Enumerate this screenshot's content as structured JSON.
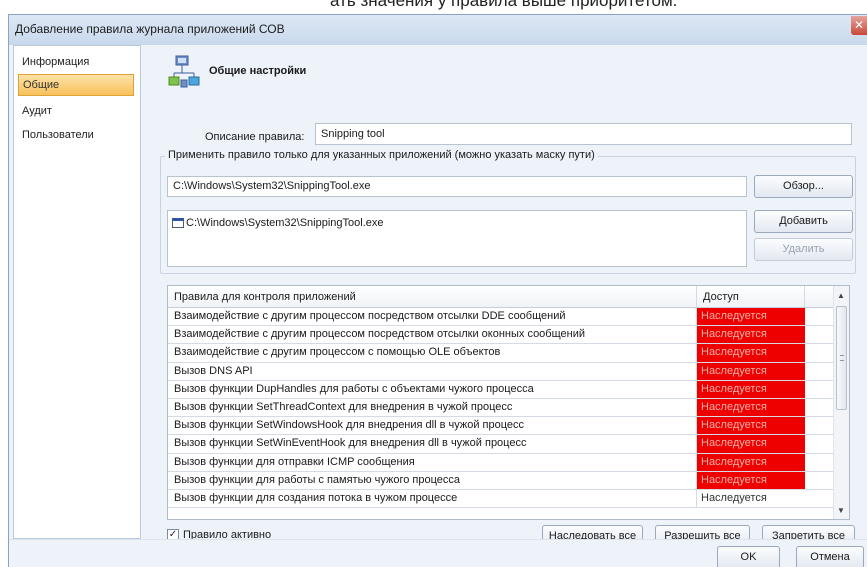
{
  "background_text": "ать значения у правила выше приоритетом.",
  "window": {
    "title": "Добавление правила журнала приложений СОВ",
    "close_glyph": "✕"
  },
  "sidebar": {
    "items": [
      {
        "label": "Информация"
      },
      {
        "label": "Общие",
        "active": true
      },
      {
        "label": "Аудит"
      },
      {
        "label": "Пользователи"
      }
    ]
  },
  "header": {
    "title": "Общие настройки",
    "icon": "settings-network-icon"
  },
  "description": {
    "label": "Описание правила:",
    "value": "Snipping tool"
  },
  "apps": {
    "legend": "Применить правило только для указанных приложений (можно указать маску пути)",
    "path_value": "C:\\Windows\\System32\\SnippingTool.exe",
    "list": [
      "C:\\Windows\\System32\\SnippingTool.exe"
    ],
    "browse_label": "Обзор...",
    "add_label": "Добавить",
    "remove_label": "Удалить"
  },
  "rules": {
    "headers": {
      "name": "Правила для контроля приложений",
      "access": "Доступ"
    },
    "rows": [
      {
        "name": "Взаимодействие с другим процессом посредством отсылки DDE сообщений",
        "access": "Наследуется",
        "highlight": true
      },
      {
        "name": "Взаимодействие с другим процессом посредством отсылки оконных сообщений",
        "access": "Наследуется",
        "highlight": true
      },
      {
        "name": "Взаимодействие с другим процессом с помощью OLE объектов",
        "access": "Наследуется",
        "highlight": true
      },
      {
        "name": "Вызов DNS API",
        "access": "Наследуется",
        "highlight": true
      },
      {
        "name": "Вызов функции DupHandles для работы с объектами чужого процесса",
        "access": "Наследуется",
        "highlight": true
      },
      {
        "name": "Вызов функции SetThreadContext для внедрения в чужой процесс",
        "access": "Наследуется",
        "highlight": true
      },
      {
        "name": "Вызов функции SetWindowsHook для внедрения dll в чужой процесс",
        "access": "Наследуется",
        "highlight": true
      },
      {
        "name": "Вызов функции SetWinEventHook для внедрения dll в чужой процесс",
        "access": "Наследуется",
        "highlight": true
      },
      {
        "name": "Вызов функции для отправки ICMP сообщения",
        "access": "Наследуется",
        "highlight": true
      },
      {
        "name": "Вызов функции для работы с памятью чужого процесса",
        "access": "Наследуется",
        "highlight": true
      },
      {
        "name": "Вызов функции для создания потока в чужом процессе",
        "access": "Наследуется",
        "highlight": false
      }
    ],
    "highlight_color": "#ee0000"
  },
  "active_checkbox": {
    "label": "Правило активно",
    "checked": true,
    "check_glyph": "✓"
  },
  "actions": {
    "inherit_all": "Наследовать все",
    "allow_all": "Разрешить все",
    "deny_all": "Запретить все"
  },
  "footer": {
    "ok": "OK",
    "cancel": "Отмена"
  }
}
